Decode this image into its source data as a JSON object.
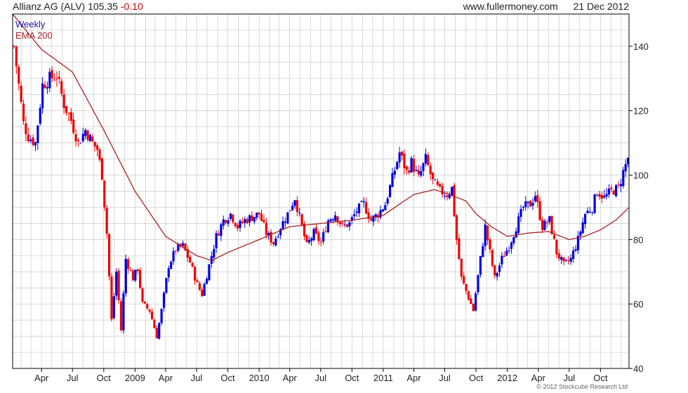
{
  "header": {
    "ticker_label": "Allianz AG (ALV)",
    "last_price": "105.35",
    "change": "-0.10",
    "source": "www.fullermoney.com",
    "date": "21 Dec 2012"
  },
  "copyright": "© 2012 Stockcube Research Ltd",
  "colors": {
    "up": "#0000dd",
    "down": "#ee0000",
    "ema": "#aa2222",
    "grid": "#c8c8c8"
  },
  "chart_data": {
    "type": "candlestick",
    "legend": [
      {
        "label": "Weekly",
        "color": "#1a1aa8"
      },
      {
        "label": "EMA 200",
        "color": "#aa2222"
      }
    ],
    "ylim": [
      40,
      150
    ],
    "yticks": [
      40,
      60,
      80,
      100,
      120,
      140
    ],
    "xlim": [
      "2008-01-07",
      "2012-12-24"
    ],
    "xticks": [
      {
        "date": "2008-04-01",
        "label": "Apr"
      },
      {
        "date": "2008-07-01",
        "label": "Jul"
      },
      {
        "date": "2008-10-01",
        "label": "Oct"
      },
      {
        "date": "2009-01-01",
        "label": "2009"
      },
      {
        "date": "2009-04-01",
        "label": "Apr"
      },
      {
        "date": "2009-07-01",
        "label": "Jul"
      },
      {
        "date": "2009-10-01",
        "label": "Oct"
      },
      {
        "date": "2010-01-01",
        "label": "2010"
      },
      {
        "date": "2010-04-01",
        "label": "Apr"
      },
      {
        "date": "2010-07-01",
        "label": "Jul"
      },
      {
        "date": "2010-10-01",
        "label": "Oct"
      },
      {
        "date": "2011-01-01",
        "label": "2011"
      },
      {
        "date": "2011-04-01",
        "label": "Apr"
      },
      {
        "date": "2011-07-01",
        "label": "Jul"
      },
      {
        "date": "2011-10-01",
        "label": "Oct"
      },
      {
        "date": "2012-01-01",
        "label": "2012"
      },
      {
        "date": "2012-04-01",
        "label": "Apr"
      },
      {
        "date": "2012-07-01",
        "label": "Jul"
      },
      {
        "date": "2012-10-01",
        "label": "Oct"
      }
    ],
    "grid": true,
    "close_anchors": [
      [
        "2008-01-11",
        140
      ],
      [
        "2008-01-25",
        128
      ],
      [
        "2008-02-08",
        116
      ],
      [
        "2008-02-22",
        112
      ],
      [
        "2008-03-14",
        110
      ],
      [
        "2008-04-04",
        128
      ],
      [
        "2008-04-25",
        130
      ],
      [
        "2008-05-16",
        131
      ],
      [
        "2008-06-06",
        122
      ],
      [
        "2008-06-27",
        117
      ],
      [
        "2008-07-18",
        110
      ],
      [
        "2008-08-08",
        114
      ],
      [
        "2008-08-29",
        110
      ],
      [
        "2008-09-12",
        108
      ],
      [
        "2008-09-26",
        100
      ],
      [
        "2008-10-10",
        82
      ],
      [
        "2008-10-24",
        55
      ],
      [
        "2008-11-07",
        70
      ],
      [
        "2008-11-21",
        52
      ],
      [
        "2008-12-05",
        74
      ],
      [
        "2008-12-26",
        68
      ],
      [
        "2009-01-09",
        71
      ],
      [
        "2009-01-23",
        60
      ],
      [
        "2009-02-13",
        58
      ],
      [
        "2009-03-06",
        50
      ],
      [
        "2009-03-20",
        58
      ],
      [
        "2009-04-10",
        72
      ],
      [
        "2009-05-01",
        77
      ],
      [
        "2009-05-22",
        78
      ],
      [
        "2009-06-12",
        73
      ],
      [
        "2009-07-03",
        66
      ],
      [
        "2009-07-17",
        63
      ],
      [
        "2009-08-07",
        72
      ],
      [
        "2009-08-28",
        81
      ],
      [
        "2009-09-18",
        86
      ],
      [
        "2009-10-09",
        88
      ],
      [
        "2009-10-30",
        84
      ],
      [
        "2009-11-20",
        86
      ],
      [
        "2009-12-11",
        87
      ],
      [
        "2010-01-01",
        88
      ],
      [
        "2010-01-22",
        82
      ],
      [
        "2010-02-12",
        79
      ],
      [
        "2010-03-05",
        84
      ],
      [
        "2010-03-26",
        88
      ],
      [
        "2010-04-16",
        93
      ],
      [
        "2010-05-07",
        84
      ],
      [
        "2010-05-21",
        78
      ],
      [
        "2010-06-11",
        82
      ],
      [
        "2010-07-02",
        79
      ],
      [
        "2010-07-23",
        86
      ],
      [
        "2010-08-13",
        88
      ],
      [
        "2010-09-03",
        84
      ],
      [
        "2010-09-24",
        85
      ],
      [
        "2010-10-15",
        89
      ],
      [
        "2010-11-05",
        91
      ],
      [
        "2010-11-26",
        86
      ],
      [
        "2010-12-17",
        88
      ],
      [
        "2011-01-07",
        91
      ],
      [
        "2011-01-28",
        99
      ],
      [
        "2011-02-18",
        107
      ],
      [
        "2011-03-11",
        101
      ],
      [
        "2011-03-25",
        104
      ],
      [
        "2011-04-15",
        99
      ],
      [
        "2011-05-06",
        105
      ],
      [
        "2011-05-27",
        98
      ],
      [
        "2011-06-17",
        95
      ],
      [
        "2011-07-08",
        94
      ],
      [
        "2011-07-22",
        96
      ],
      [
        "2011-08-05",
        80
      ],
      [
        "2011-08-19",
        68
      ],
      [
        "2011-09-09",
        62
      ],
      [
        "2011-09-23",
        58
      ],
      [
        "2011-10-14",
        74
      ],
      [
        "2011-10-28",
        84
      ],
      [
        "2011-11-11",
        76
      ],
      [
        "2011-11-25",
        68
      ],
      [
        "2011-12-16",
        74
      ],
      [
        "2012-01-06",
        78
      ],
      [
        "2012-01-27",
        84
      ],
      [
        "2012-02-17",
        90
      ],
      [
        "2012-03-09",
        91
      ],
      [
        "2012-03-23",
        94
      ],
      [
        "2012-04-13",
        84
      ],
      [
        "2012-05-04",
        86
      ],
      [
        "2012-05-25",
        76
      ],
      [
        "2012-06-15",
        72
      ],
      [
        "2012-07-06",
        74
      ],
      [
        "2012-07-27",
        80
      ],
      [
        "2012-08-17",
        88
      ],
      [
        "2012-09-07",
        90
      ],
      [
        "2012-09-21",
        95
      ],
      [
        "2012-10-12",
        93
      ],
      [
        "2012-11-02",
        95
      ],
      [
        "2012-11-23",
        96
      ],
      [
        "2012-12-07",
        101
      ],
      [
        "2012-12-21",
        105.35
      ]
    ],
    "ema_anchors": [
      [
        "2008-01-07",
        150
      ],
      [
        "2008-04-01",
        139
      ],
      [
        "2008-07-01",
        132
      ],
      [
        "2008-10-01",
        114
      ],
      [
        "2009-01-01",
        95
      ],
      [
        "2009-04-01",
        81
      ],
      [
        "2009-07-01",
        75
      ],
      [
        "2009-08-15",
        73.5
      ],
      [
        "2009-10-01",
        76
      ],
      [
        "2010-01-01",
        80
      ],
      [
        "2010-04-01",
        84
      ],
      [
        "2010-07-01",
        85
      ],
      [
        "2010-10-01",
        86
      ],
      [
        "2011-01-01",
        87.5
      ],
      [
        "2011-04-01",
        94
      ],
      [
        "2011-06-01",
        95.5
      ],
      [
        "2011-07-15",
        94
      ],
      [
        "2011-09-01",
        92
      ],
      [
        "2011-10-01",
        88
      ],
      [
        "2011-11-15",
        84
      ],
      [
        "2012-01-01",
        81
      ],
      [
        "2012-03-01",
        82
      ],
      [
        "2012-05-01",
        82.5
      ],
      [
        "2012-07-01",
        80
      ],
      [
        "2012-08-15",
        81
      ],
      [
        "2012-10-01",
        83
      ],
      [
        "2012-11-15",
        86
      ],
      [
        "2012-12-24",
        90
      ]
    ]
  }
}
